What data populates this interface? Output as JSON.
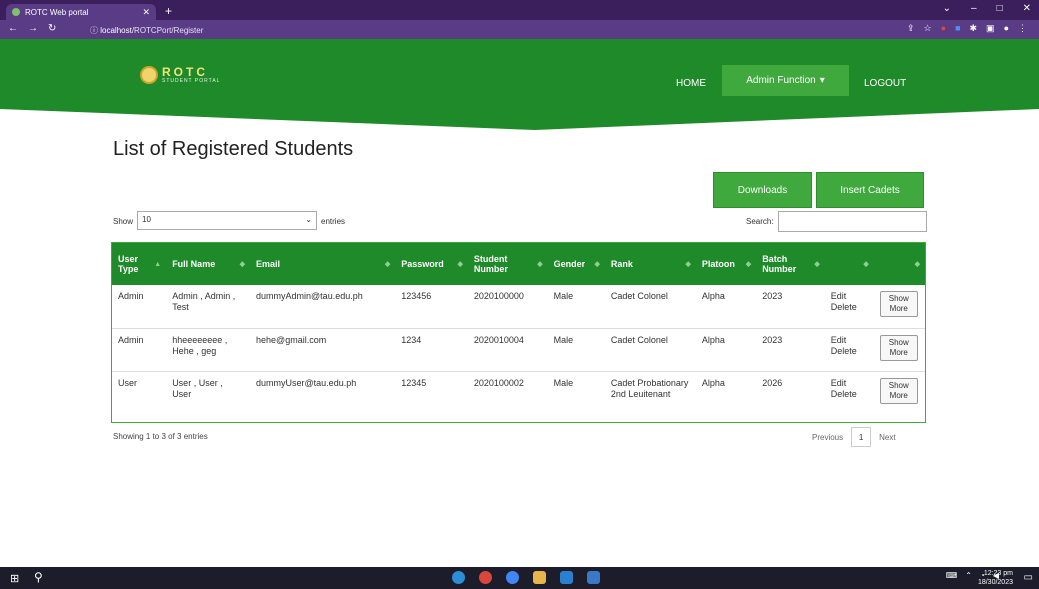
{
  "browser": {
    "tab_title": "ROTC Web portal",
    "url_host": "localhost",
    "url_path": "/ROTCPort/Register"
  },
  "site": {
    "brand": "ROTC",
    "brand_sub": "STUDENT PORTAL",
    "nav": {
      "home": "HOME",
      "admin": "Admin Function",
      "logout": "LOGOUT"
    }
  },
  "page": {
    "title": "List of Registered Students",
    "downloads_label": "Downloads",
    "insert_label": "Insert Cadets",
    "show_label": "Show",
    "show_value": "10",
    "entries_label": "entries",
    "search_label": "Search:",
    "search_value": ""
  },
  "table": {
    "headers": [
      "User Type",
      "Full Name",
      "Email",
      "Password",
      "Student Number",
      "Gender",
      "Rank",
      "Platoon",
      "Batch Number",
      "",
      ""
    ],
    "rows": [
      {
        "type": "Admin",
        "name": "Admin , Admin , Test",
        "email": "dummyAdmin@tau.edu.ph",
        "password": "123456",
        "student_number": "2020100000",
        "gender": "Male",
        "rank": "Cadet Colonel",
        "platoon": "Alpha",
        "batch": "2023",
        "edit": "Edit",
        "delete": "Delete",
        "show_more": "Show More"
      },
      {
        "type": "Admin",
        "name": "hheeeeeeee , Hehe , geg",
        "email": "hehe@gmail.com",
        "password": "1234",
        "student_number": "2020010004",
        "gender": "Male",
        "rank": "Cadet Colonel",
        "platoon": "Alpha",
        "batch": "2023",
        "edit": "Edit",
        "delete": "Delete",
        "show_more": "Show More"
      },
      {
        "type": "User",
        "name": "User , User , User",
        "email": "dummyUser@tau.edu.ph",
        "password": "12345",
        "student_number": "2020100002",
        "gender": "Male",
        "rank": "Cadet Probationary 2nd Leuitenant",
        "platoon": "Alpha",
        "batch": "2026",
        "edit": "Edit",
        "delete": "Delete",
        "show_more": "Show More"
      }
    ]
  },
  "footer": {
    "showing": "Showing 1 to 3 of 3 entries",
    "previous": "Previous",
    "page": "1",
    "next": "Next"
  },
  "taskbar": {
    "time": "12:23 pm",
    "date": "18/30/2023"
  },
  "colors": {
    "brand_green": "#1e8a2a",
    "button_green": "#3fa93d",
    "browser_purple": "#5a3b86"
  }
}
